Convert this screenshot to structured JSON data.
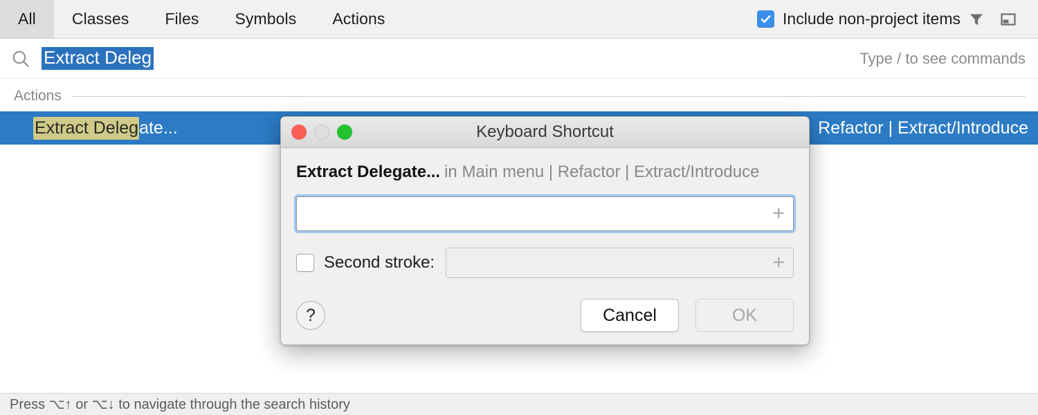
{
  "header": {
    "tabs": [
      {
        "label": "All",
        "selected": true
      },
      {
        "label": "Classes",
        "selected": false
      },
      {
        "label": "Files",
        "selected": false
      },
      {
        "label": "Symbols",
        "selected": false
      },
      {
        "label": "Actions",
        "selected": false
      }
    ],
    "include_non_project": {
      "label": "Include non-project items",
      "checked": true,
      "color": "#3b8fe8"
    },
    "filter_icon": "filter-funnel-icon",
    "preview_icon": "preview-panel-icon"
  },
  "search": {
    "icon": "search-icon",
    "value": "Extract Deleg",
    "selected": true,
    "selection_color": "#2b72bd",
    "hint": "Type / to see commands"
  },
  "results": {
    "group_label": "Actions",
    "row": {
      "match_text": "Extract Deleg",
      "rest_text": "ate...",
      "path": "Refactor | Extract/Introduce",
      "selected": true,
      "row_color": "#2c7bc4",
      "match_highlight_color": "#cfc98a"
    }
  },
  "status": {
    "text": "Press ⌥↑ or ⌥↓ to navigate through the search history"
  },
  "dialog": {
    "title": "Keyboard Shortcut",
    "window_controls": {
      "close": "close-button",
      "minimize": "minimize-button",
      "zoom": "zoom-button"
    },
    "action_name": "Extract Delegate...",
    "action_path": "in Main menu | Refactor | Extract/Introduce",
    "first_stroke": {
      "value": "",
      "add_glyph": "+",
      "focused": true
    },
    "second_stroke": {
      "label": "Second stroke:",
      "checked": false,
      "value": "",
      "add_glyph": "+",
      "enabled": false
    },
    "help_label": "?",
    "cancel_label": "Cancel",
    "ok_label": "OK",
    "ok_enabled": false
  }
}
